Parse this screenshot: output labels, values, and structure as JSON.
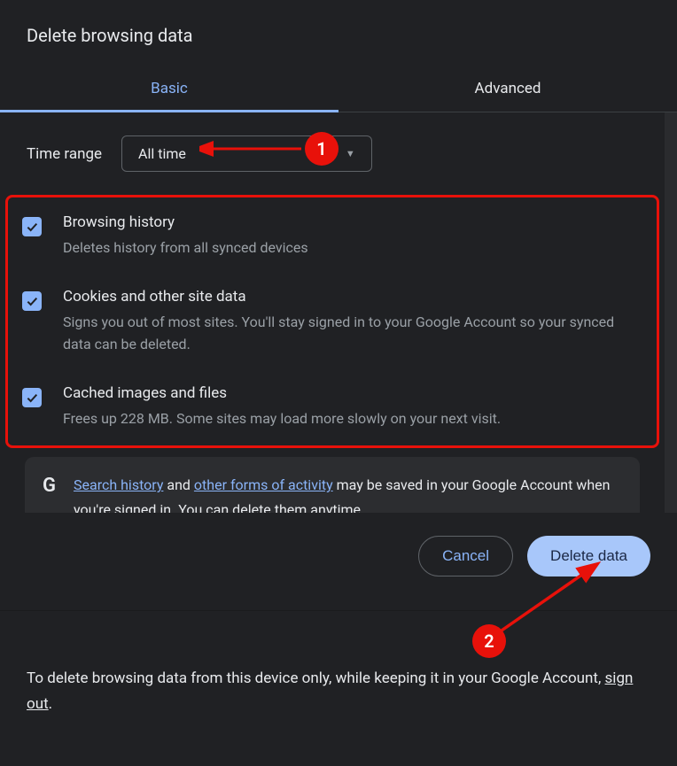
{
  "dialog": {
    "title": "Delete browsing data",
    "tabs": {
      "basic": "Basic",
      "advanced": "Advanced"
    },
    "time_range": {
      "label": "Time range",
      "value": "All time"
    },
    "options": {
      "browsing_history": {
        "title": "Browsing history",
        "desc": "Deletes history from all synced devices",
        "checked": true
      },
      "cookies": {
        "title": "Cookies and other site data",
        "desc": "Signs you out of most sites. You'll stay signed in to your Google Account so your synced data can be deleted.",
        "checked": true
      },
      "cache": {
        "title": "Cached images and files",
        "desc": "Frees up 228 MB. Some sites may load more slowly on your next visit.",
        "checked": true
      }
    },
    "google_card": {
      "link1": "Search history",
      "mid": " and ",
      "link2": "other forms of activity",
      "tail": " may be saved in your Google Account when you're signed in. You can delete them anytime."
    },
    "buttons": {
      "cancel": "Cancel",
      "delete": "Delete data"
    },
    "footer": {
      "prefix": "To delete browsing data from this device only, while keeping it in your Google Account, ",
      "link": "sign out",
      "suffix": "."
    }
  },
  "annotations": {
    "step1": "1",
    "step2": "2"
  }
}
